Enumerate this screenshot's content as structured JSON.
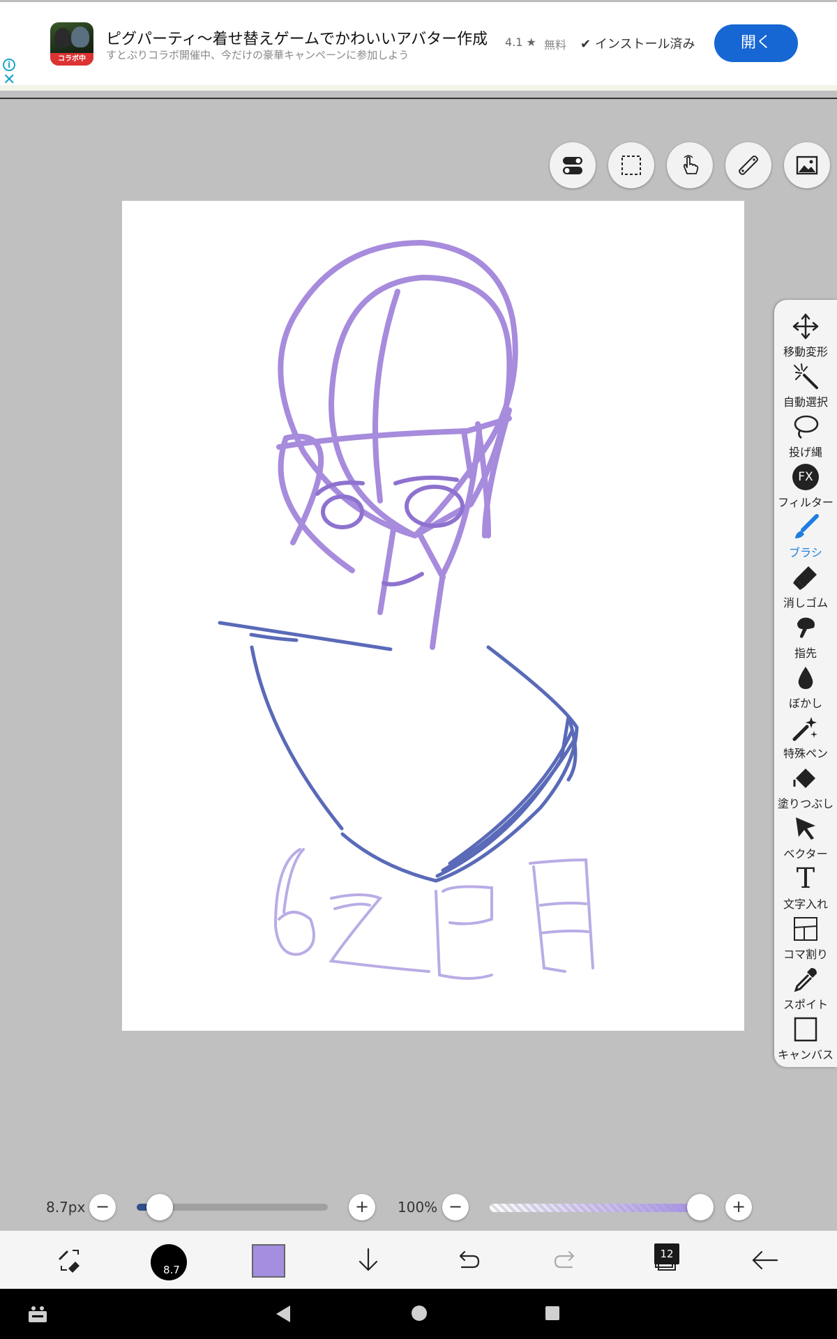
{
  "ad": {
    "badge": "コラボ中",
    "title": "ピグパーティ〜着せ替えゲームでかわいいアバター作成",
    "subtitle": "すとぷりコラボ開催中、今だけの豪華キャンペーンに参加しよう",
    "rating": "4.1 ★",
    "price": "無料",
    "installed": "インストール済み",
    "open_button": "開く",
    "info_glyph": "i",
    "close_glyph": "✕"
  },
  "top_tools": [
    "toggle-icon",
    "selection-rect-icon",
    "hand-touch-icon",
    "ruler-icon",
    "image-icon"
  ],
  "canvas": {
    "handwriting": "6ZB月",
    "stroke_colors": {
      "head": "#a78bdc",
      "body": "#5a6ab8",
      "text": "#b9ace6",
      "face": "#8e72cf"
    }
  },
  "palette": {
    "tools": [
      {
        "icon": "move-transform-icon",
        "label": "移動変形"
      },
      {
        "icon": "magic-wand-icon",
        "label": "自動選択"
      },
      {
        "icon": "lasso-icon",
        "label": "投げ縄"
      },
      {
        "icon": "fx-icon",
        "label": "フィルター",
        "glyph": "FX"
      },
      {
        "icon": "brush-icon",
        "label": "ブラシ",
        "active": true
      },
      {
        "icon": "eraser-icon",
        "label": "消しゴム"
      },
      {
        "icon": "finger-icon",
        "label": "指先"
      },
      {
        "icon": "blur-drop-icon",
        "label": "ぼかし"
      },
      {
        "icon": "special-pen-icon",
        "label": "特殊ペン"
      },
      {
        "icon": "fill-bucket-icon",
        "label": "塗りつぶし"
      },
      {
        "icon": "vector-cursor-icon",
        "label": "ベクター"
      },
      {
        "icon": "text-t-icon",
        "label": "文字入れ",
        "glyph": "T"
      },
      {
        "icon": "frame-divide-icon",
        "label": "コマ割り"
      },
      {
        "icon": "eyedropper-icon",
        "label": "スポイト"
      },
      {
        "icon": "canvas-square-icon",
        "label": "キャンバス"
      }
    ]
  },
  "sliders": {
    "brush_size_label": "8.7px",
    "brush_size_fraction": 0.12,
    "opacity_label": "100%",
    "opacity_fraction": 1.0,
    "minus_glyph": "−",
    "plus_glyph": "+"
  },
  "bottom_bar": {
    "brush_size_text": "8.7",
    "color": "#a38ee0",
    "layer_count": "12"
  }
}
